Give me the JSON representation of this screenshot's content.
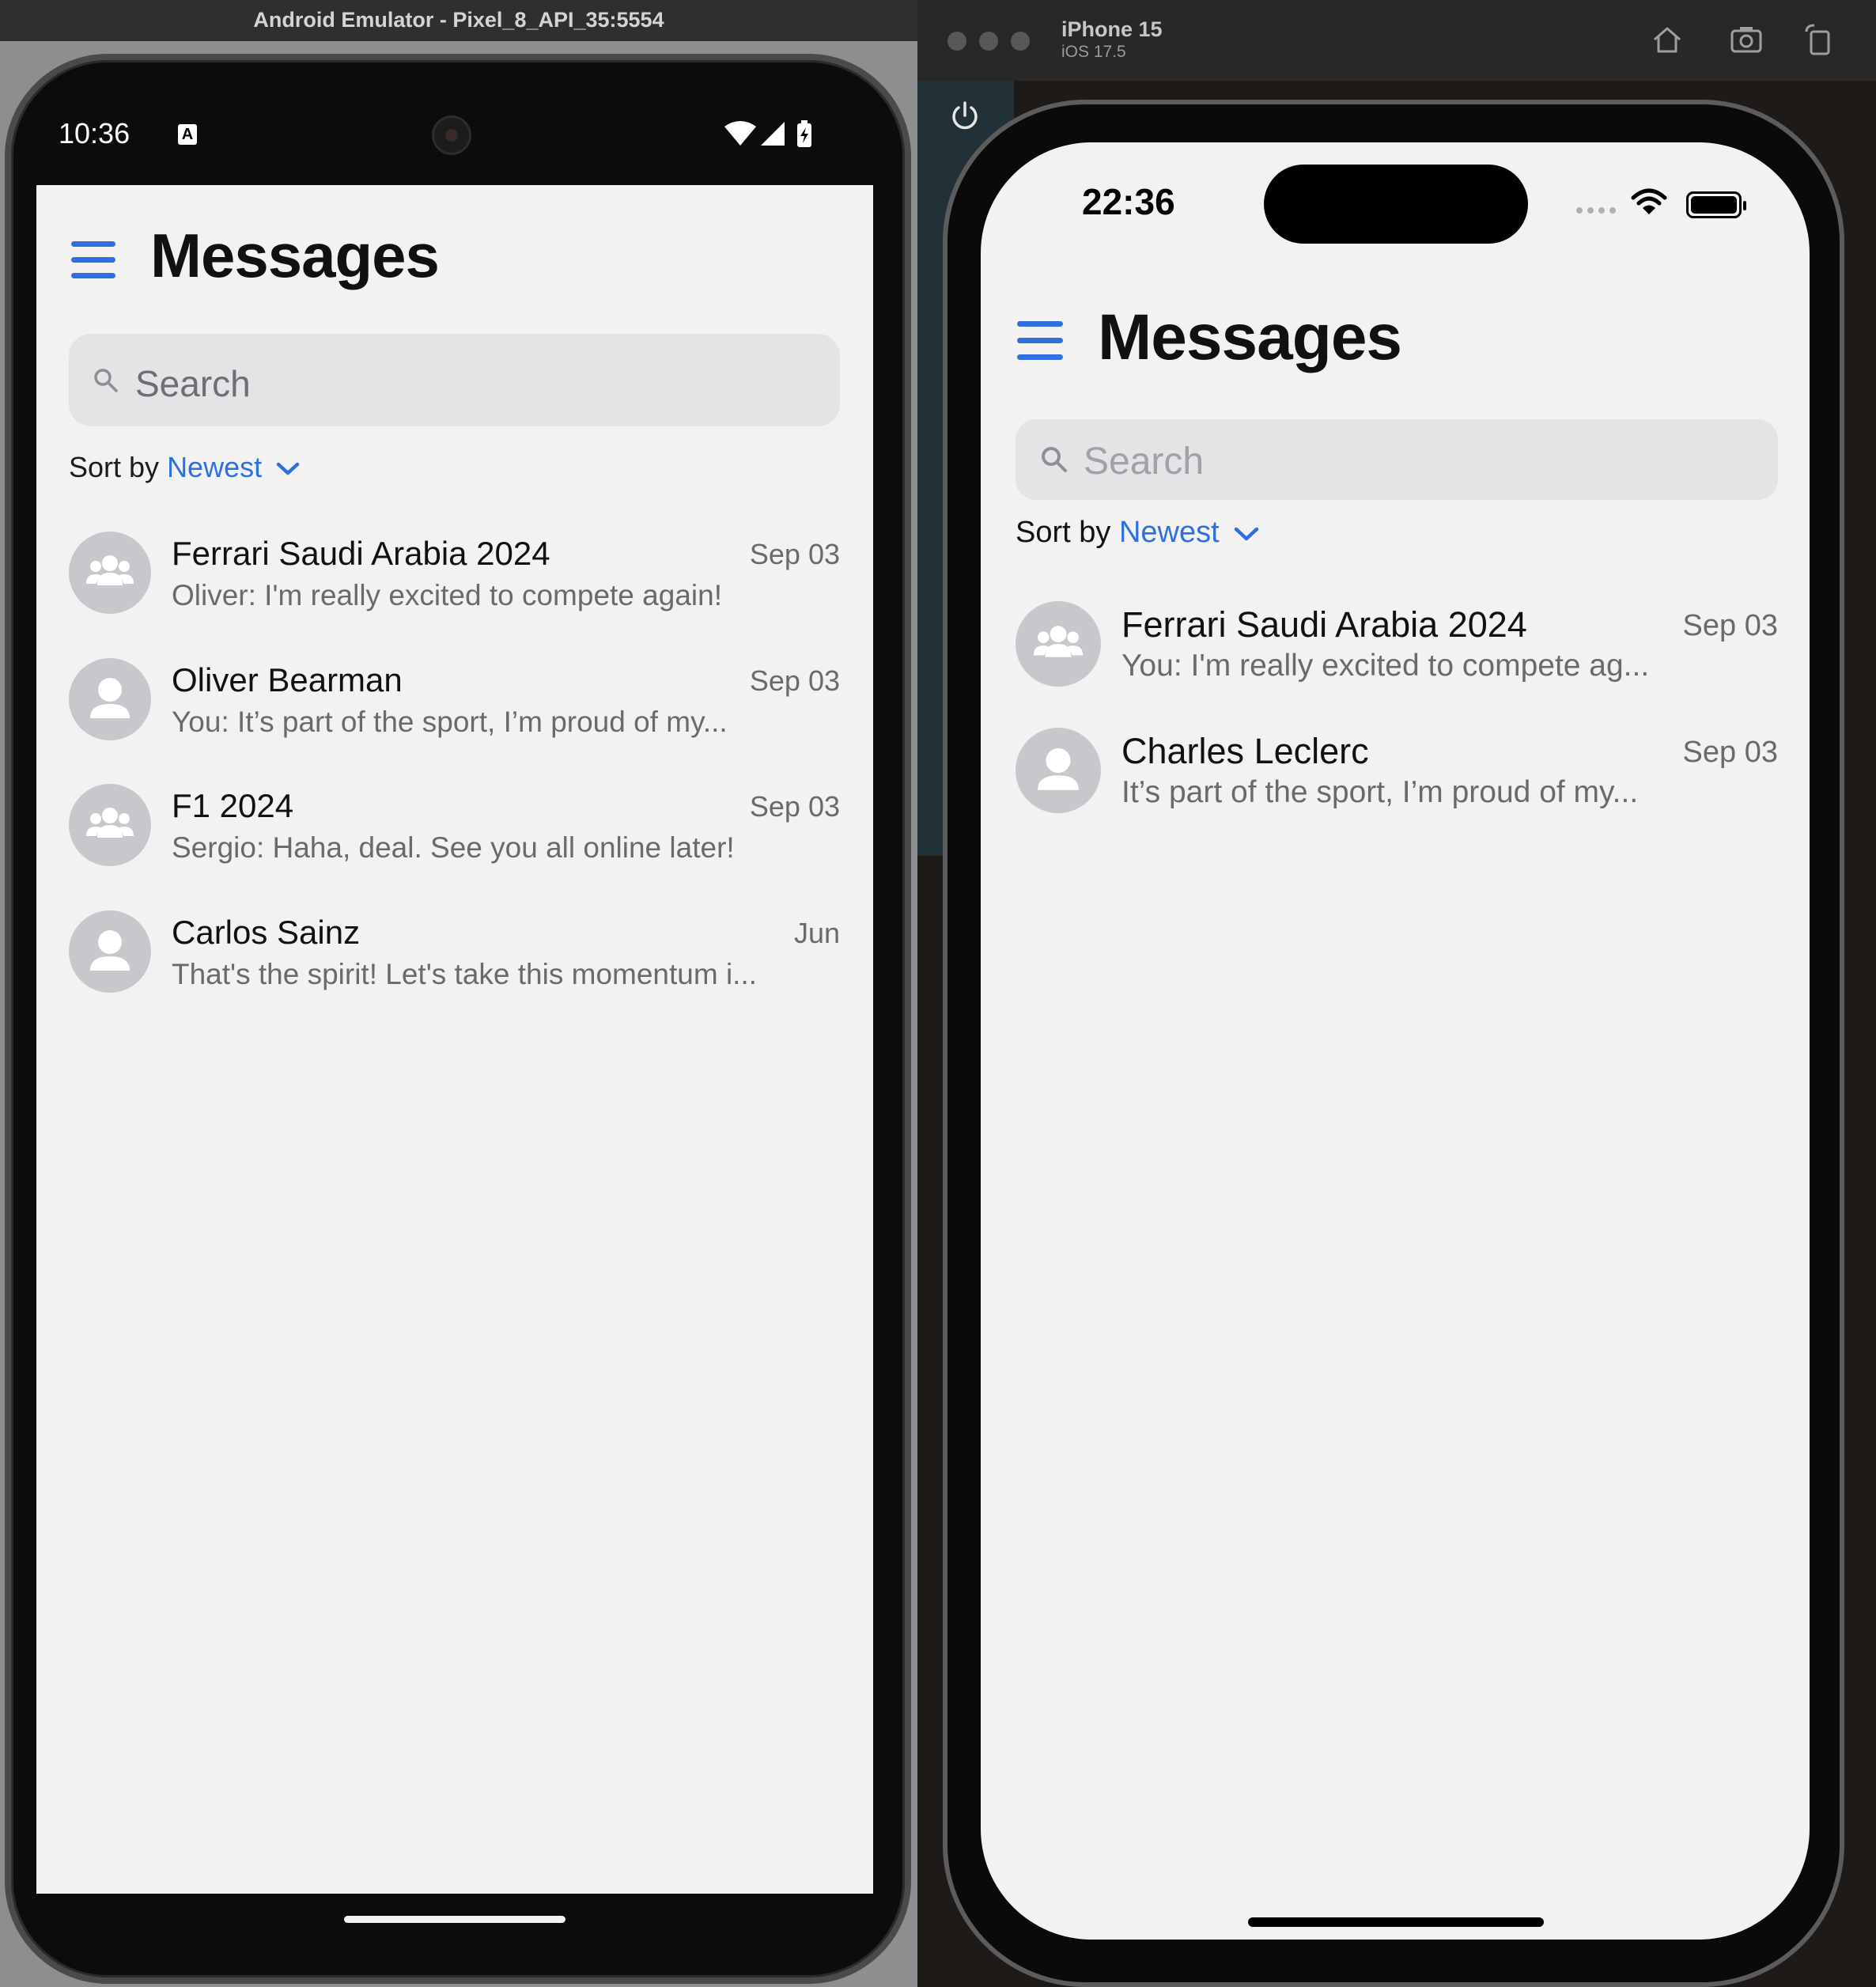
{
  "android": {
    "window_title": "Android Emulator - Pixel_8_API_35:5554",
    "status": {
      "time": "10:36",
      "badge": "A"
    },
    "app": {
      "title": "Messages",
      "search_placeholder": "Search",
      "sort_label": "Sort by",
      "sort_value": "Newest",
      "conversations": [
        {
          "name": "Ferrari Saudi Arabia 2024",
          "preview": "Oliver: I'm really excited to compete again!",
          "date": "Sep 03",
          "avatar": "group-icon"
        },
        {
          "name": "Oliver Bearman",
          "preview": "You: It’s part of the sport, I’m proud of my...",
          "date": "Sep 03",
          "avatar": "person-icon"
        },
        {
          "name": "F1 2024",
          "preview": "Sergio: Haha, deal. See you all online later!",
          "date": "Sep 03",
          "avatar": "group-icon"
        },
        {
          "name": "Carlos Sainz",
          "preview": "That's the spirit! Let's take this momentum i...",
          "date": "Jun",
          "avatar": "person-icon"
        }
      ]
    }
  },
  "ios": {
    "device_name": "iPhone 15",
    "os_version": "iOS 17.5",
    "status": {
      "time": "22:36"
    },
    "app": {
      "title": "Messages",
      "search_placeholder": "Search",
      "sort_label": "Sort by",
      "sort_value": "Newest",
      "conversations": [
        {
          "name": "Ferrari Saudi Arabia 2024",
          "preview": "You: I'm really excited to compete ag...",
          "date": "Sep 03",
          "avatar": "group-icon"
        },
        {
          "name": "Charles Leclerc",
          "preview": "It’s part of the sport, I’m proud of my...",
          "date": "Sep 03",
          "avatar": "person-icon"
        }
      ]
    }
  },
  "colors": {
    "accent": "#2f6fe0",
    "screen_bg": "#f2f2f2",
    "avatar_bg": "#c7c7cc",
    "search_bg": "#e4e4e7"
  }
}
